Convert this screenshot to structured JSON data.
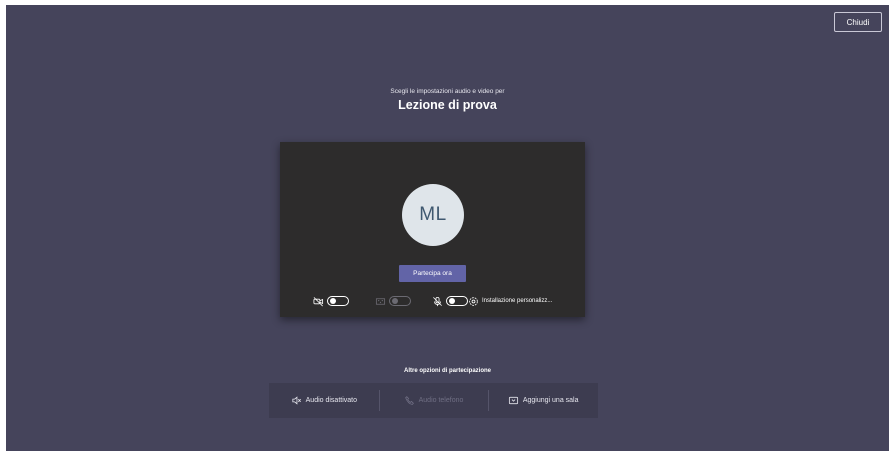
{
  "header": {
    "close_label": "Chiudi"
  },
  "prejoin": {
    "subtitle": "Scegli le impostazioni audio e video per",
    "meeting_title": "Lezione di prova"
  },
  "preview": {
    "avatar_initials": "ML",
    "join_button_label": "Partecipa ora",
    "controls": {
      "camera": {
        "icon": "camera-off-icon",
        "state": "off"
      },
      "background_blur": {
        "icon": "background-blur-icon",
        "state": "off",
        "enabled": false
      },
      "microphone": {
        "icon": "mic-off-icon",
        "state": "off"
      },
      "device_settings": {
        "icon": "gear-icon",
        "label": "Installazione personalizz..."
      }
    }
  },
  "other_options": {
    "title": "Altre opzioni di partecipazione",
    "items": [
      {
        "icon": "speaker-off-icon",
        "label": "Audio disattivato",
        "enabled": true
      },
      {
        "icon": "phone-icon",
        "label": "Audio telefono",
        "enabled": false
      },
      {
        "icon": "cast-icon",
        "label": "Aggiungi una sala",
        "enabled": true
      }
    ]
  },
  "colors": {
    "stage_background": "#45445b",
    "preview_background": "#2d2c2c",
    "accent": "#6264a7",
    "avatar_background": "#dfe5ea",
    "avatar_text": "#3f5870"
  }
}
